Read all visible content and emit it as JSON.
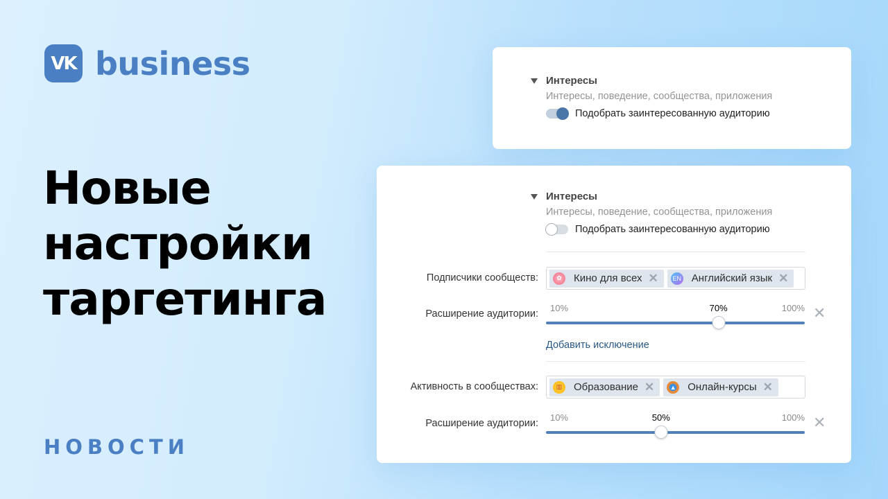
{
  "brand": {
    "mark": "VK",
    "name": "business",
    "color": "#4a7fc3"
  },
  "headline": {
    "lines": [
      "Новые",
      "настройки",
      "таргетинга"
    ]
  },
  "category": "НОВОСТИ",
  "card_top": {
    "section_title": "Интересы",
    "section_subtitle": "Интересы, поведение, сообщества, приложения",
    "toggle_label": "Подобрать заинтересованную аудиторию",
    "toggle_on": true
  },
  "card_bottom": {
    "section_title": "Интересы",
    "section_subtitle": "Интересы, поведение, сообщества, приложения",
    "toggle_label": "Подобрать заинтересованную аудиторию",
    "toggle_on": false,
    "subscribers": {
      "label": "Подписчики сообществ:",
      "tags": [
        {
          "icon": "film-reel-icon",
          "label": "Кино для всех"
        },
        {
          "icon": "english-language-icon",
          "label": "Английский язык"
        }
      ],
      "expansion": {
        "label": "Расширение аудитории:",
        "min_label": "10%",
        "max_label": "100%",
        "value_label": "70%",
        "min": 10,
        "max": 100,
        "value": 70
      }
    },
    "add_exclusion_link": "Добавить исключение",
    "activity": {
      "label": "Активность в сообществах:",
      "tags": [
        {
          "icon": "books-icon",
          "label": "Образование"
        },
        {
          "icon": "graduation-cap-icon",
          "label": "Онлайн-курсы"
        }
      ],
      "expansion": {
        "label": "Расширение аудитории:",
        "min_label": "10%",
        "max_label": "100%",
        "value_label": "50%",
        "min": 10,
        "max": 100,
        "value": 50
      }
    }
  }
}
